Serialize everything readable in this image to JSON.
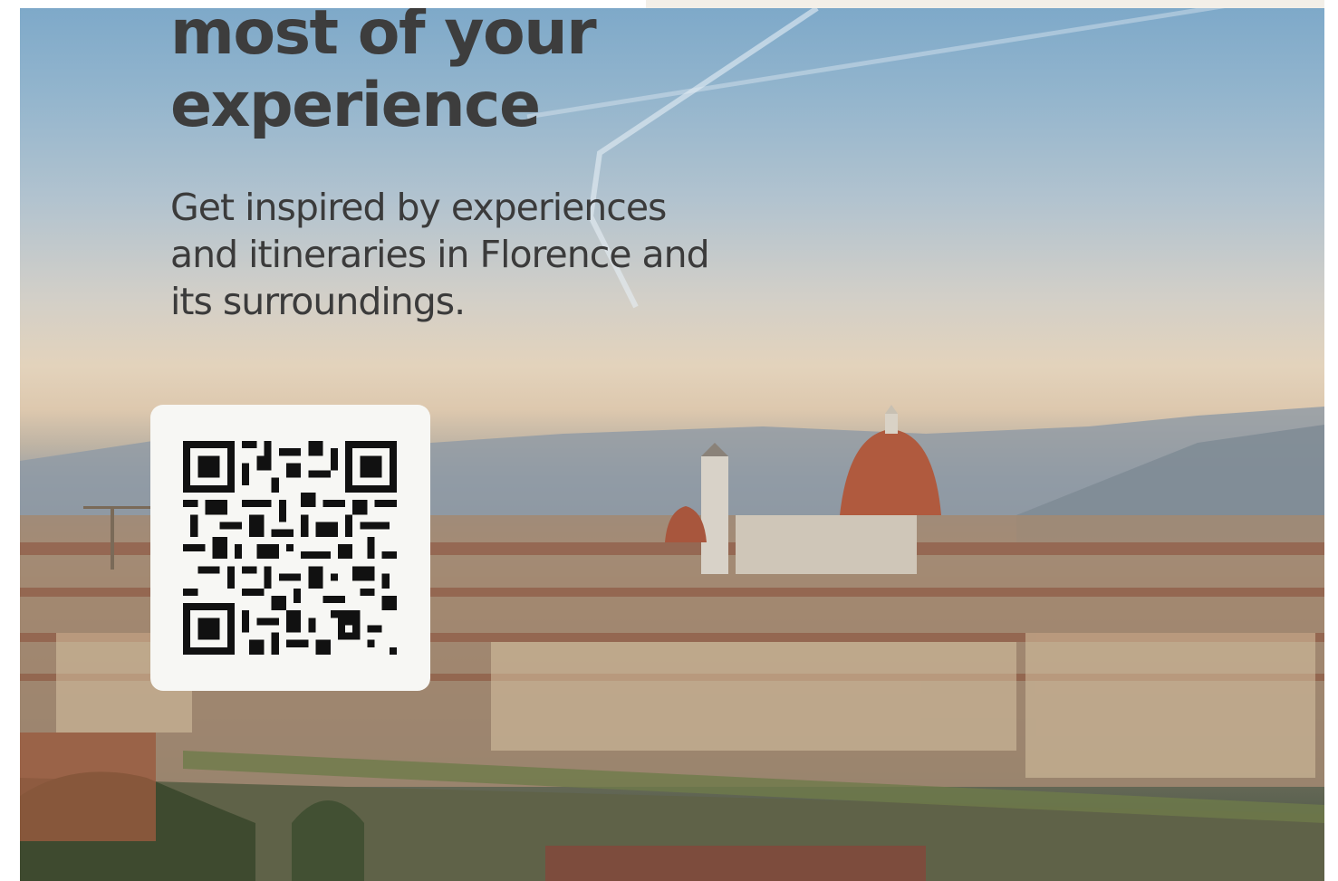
{
  "hero": {
    "headline": "most of your\nexperience",
    "subtitle": "Get inspired by experiences and itineraries in Florence and its surroundings.",
    "image_alt": "Florence skyline with cathedral dome"
  },
  "qr": {
    "label": "qr-code"
  },
  "colors": {
    "headline": "#3d3d3d",
    "card": "#f7f7f4"
  }
}
